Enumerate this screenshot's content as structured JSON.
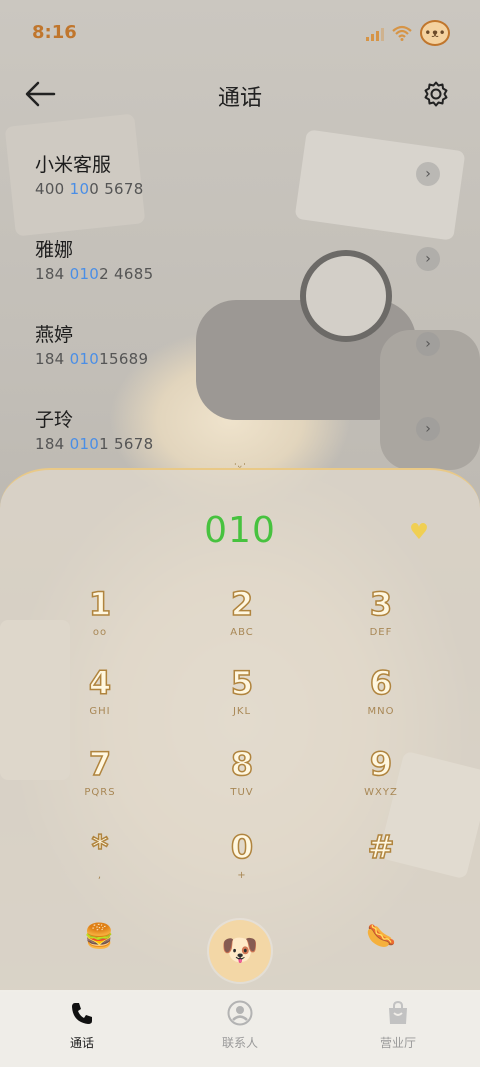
{
  "status_bar": {
    "time": "8:16"
  },
  "nav": {
    "title": "通话",
    "back_icon": "arrow-left-icon",
    "settings_icon": "gear-icon"
  },
  "recent_calls": [
    {
      "name": "小米客服",
      "number_pre": "400 ",
      "number_hl": "10",
      "number_post": "0 5678"
    },
    {
      "name": "雅娜",
      "number_pre": "184 ",
      "number_hl": "010",
      "number_post": "2 4685"
    },
    {
      "name": "燕婷",
      "number_pre": "184 ",
      "number_hl": "010",
      "number_post": "15689"
    },
    {
      "name": "子玲",
      "number_pre": "184 ",
      "number_hl": "010",
      "number_post": "1 5678"
    }
  ],
  "dialpad": {
    "display": "010",
    "keys": [
      {
        "digit": "1",
        "letters": "oo"
      },
      {
        "digit": "2",
        "letters": "ABC"
      },
      {
        "digit": "3",
        "letters": "DEF"
      },
      {
        "digit": "4",
        "letters": "GHI"
      },
      {
        "digit": "5",
        "letters": "JKL"
      },
      {
        "digit": "6",
        "letters": "MNO"
      },
      {
        "digit": "7",
        "letters": "PQRS"
      },
      {
        "digit": "8",
        "letters": "TUV"
      },
      {
        "digit": "9",
        "letters": "WXYZ"
      },
      {
        "digit": "*",
        "letters": ","
      },
      {
        "digit": "0",
        "letters": "+"
      },
      {
        "digit": "#",
        "letters": ""
      }
    ],
    "left_button_icon": "burger-icon",
    "right_button_icon": "hotdog-icon",
    "call_button_icon": "puppy-call-icon"
  },
  "tab_bar": [
    {
      "label": "通话",
      "icon": "phone-icon",
      "active": true
    },
    {
      "label": "联系人",
      "icon": "contact-icon",
      "active": false
    },
    {
      "label": "营业厅",
      "icon": "bag-icon",
      "active": false
    }
  ],
  "colors": {
    "time": "#c0762d",
    "display_number": "#47c23f",
    "number_highlight": "#4a8ee6",
    "heart": "#f0cf53"
  }
}
